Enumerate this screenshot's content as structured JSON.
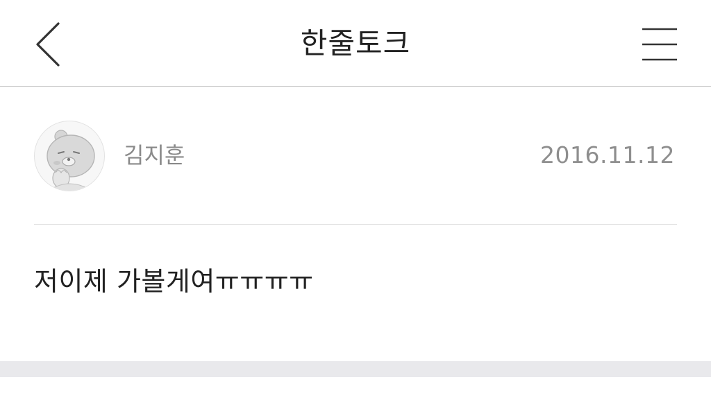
{
  "header": {
    "title": "한줄토크",
    "back_icon": "chevron-left-icon",
    "menu_icon": "hamburger-menu-icon"
  },
  "post": {
    "author": "김지훈",
    "date": "2016.11.12",
    "avatar_icon": "bear-avatar-icon",
    "content": "저이제 가볼게여ㅠㅠㅠㅠ"
  },
  "colors": {
    "divider": "#dcdcdc",
    "footer_band": "#e9e9ec",
    "meta_text": "#8a8a8a",
    "body_text": "#222222"
  }
}
